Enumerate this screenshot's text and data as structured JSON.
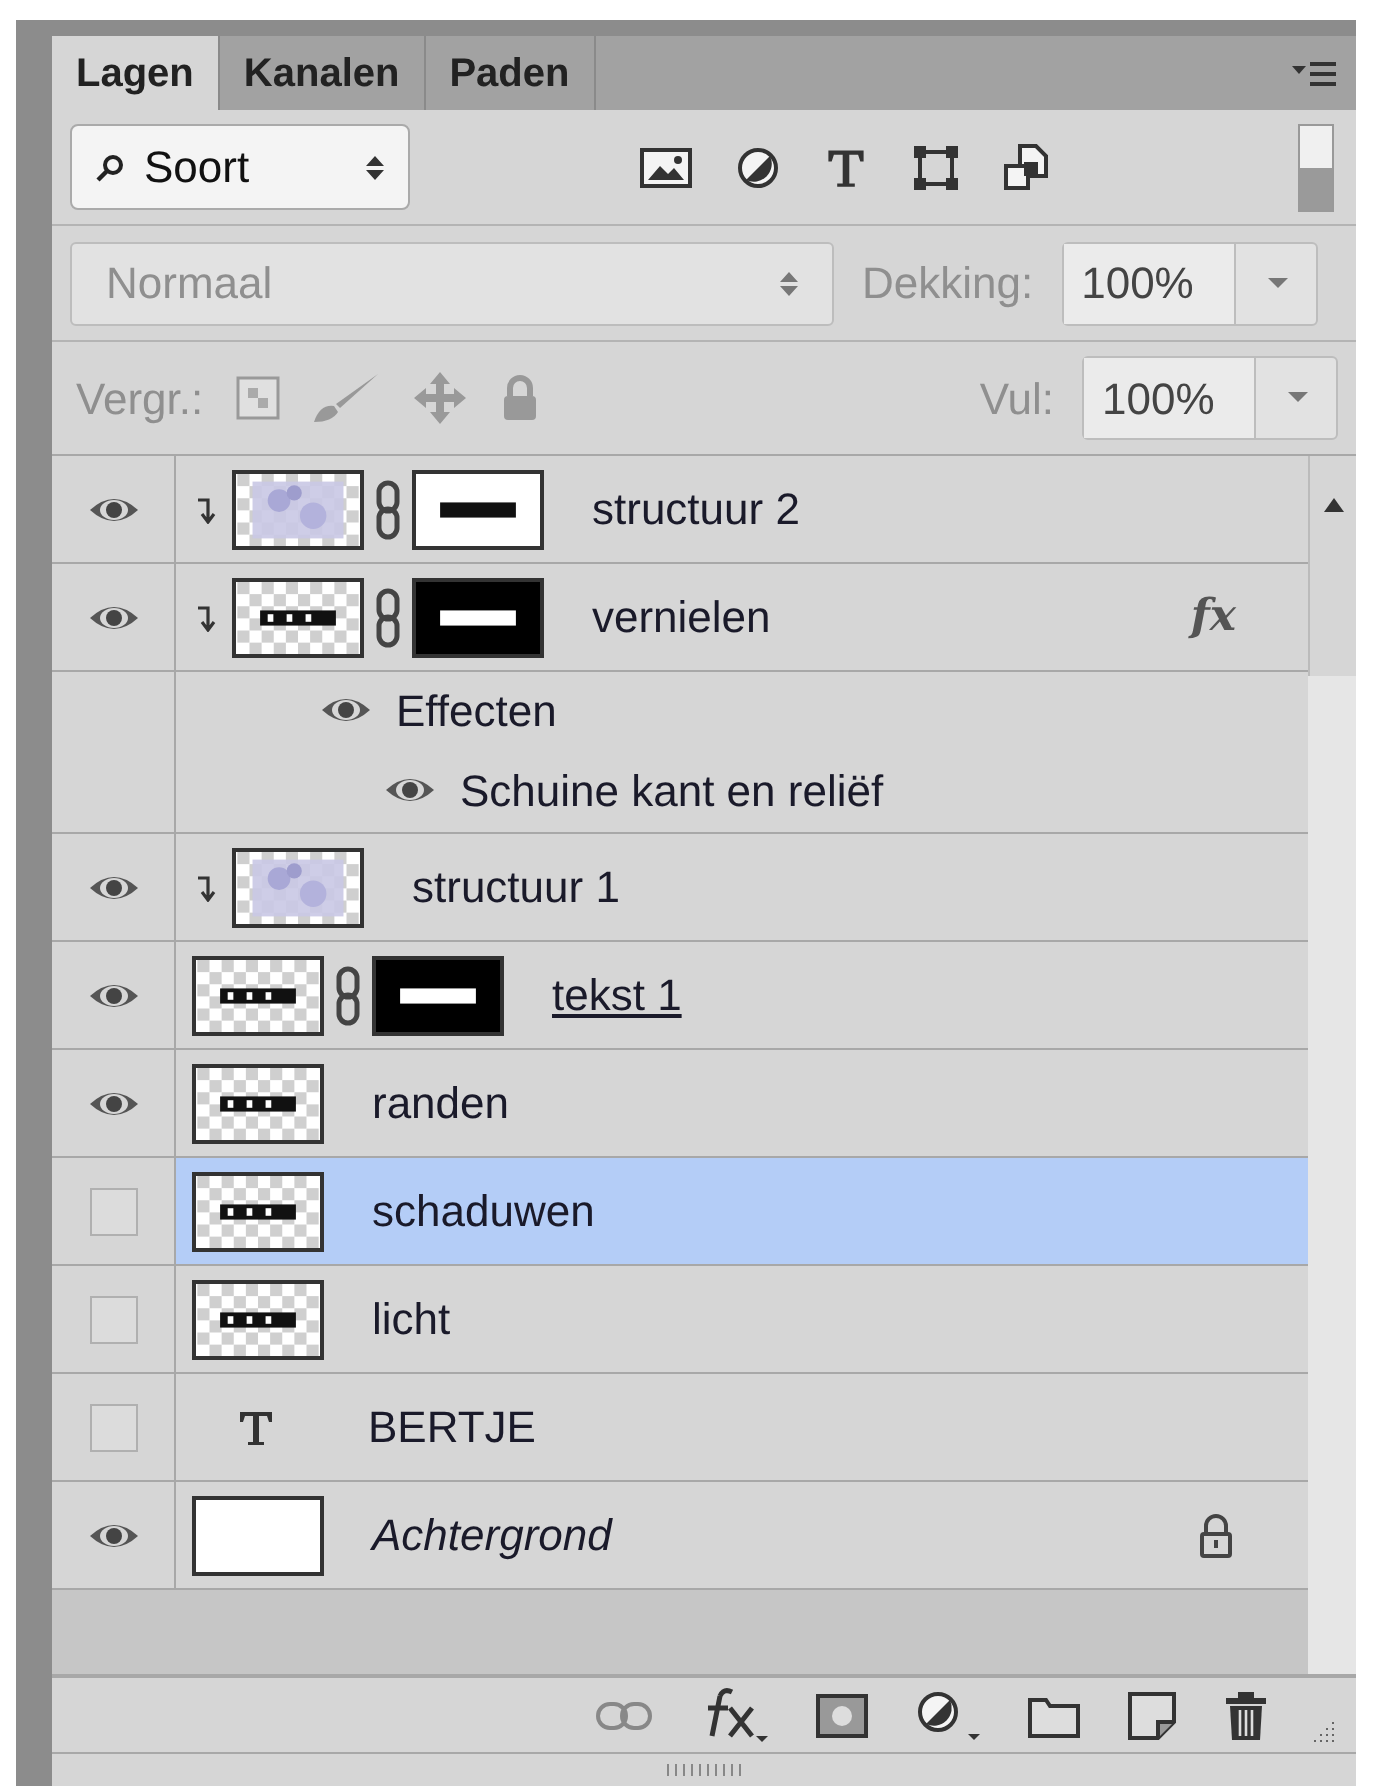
{
  "tabs": [
    {
      "label": "Lagen",
      "selected": true
    },
    {
      "label": "Kanalen",
      "selected": false
    },
    {
      "label": "Paden",
      "selected": false
    }
  ],
  "filter": {
    "value": "Soort",
    "on": true
  },
  "blend": {
    "value": "Normaal",
    "disabled": true
  },
  "opacity": {
    "label": "Dekking:",
    "value": "100%"
  },
  "lock": {
    "label": "Vergr.:"
  },
  "fill": {
    "label": "Vul:",
    "value": "100%"
  },
  "layers": [
    {
      "name": "structuur 2",
      "visible": true,
      "selected": false,
      "clipped": true,
      "thumbnail": {
        "kind": "texture"
      },
      "mask": {
        "kind": "light"
      }
    },
    {
      "name": "vernielen",
      "visible": true,
      "selected": false,
      "clipped": true,
      "thumbnail": {
        "kind": "text"
      },
      "mask": {
        "kind": "dark"
      },
      "fx": "fx",
      "effects": {
        "label": "Effecten",
        "visible": true,
        "children": [
          {
            "name": "Schuine kant en reliëf",
            "visible": true
          }
        ]
      }
    },
    {
      "name": "structuur 1",
      "visible": true,
      "selected": false,
      "clipped": true,
      "thumbnail": {
        "kind": "texture"
      }
    },
    {
      "name": "tekst 1",
      "visible": true,
      "selected": false,
      "clipped": false,
      "thumbnail": {
        "kind": "text"
      },
      "mask": {
        "kind": "dark"
      },
      "underlined": true
    },
    {
      "name": "randen",
      "visible": true,
      "selected": false,
      "clipped": false,
      "thumbnail": {
        "kind": "text"
      }
    },
    {
      "name": "schaduwen",
      "visible": false,
      "selected": true,
      "clipped": false,
      "thumbnail": {
        "kind": "text"
      }
    },
    {
      "name": "licht",
      "visible": false,
      "selected": false,
      "clipped": false,
      "thumbnail": {
        "kind": "text"
      }
    },
    {
      "name": "BERTJE",
      "visible": false,
      "selected": false,
      "clipped": false,
      "thumbnail": {
        "kind": "type"
      }
    },
    {
      "name": "Achtergrond",
      "visible": true,
      "selected": false,
      "clipped": false,
      "thumbnail": {
        "kind": "white"
      },
      "italic": true,
      "locked": true
    }
  ]
}
